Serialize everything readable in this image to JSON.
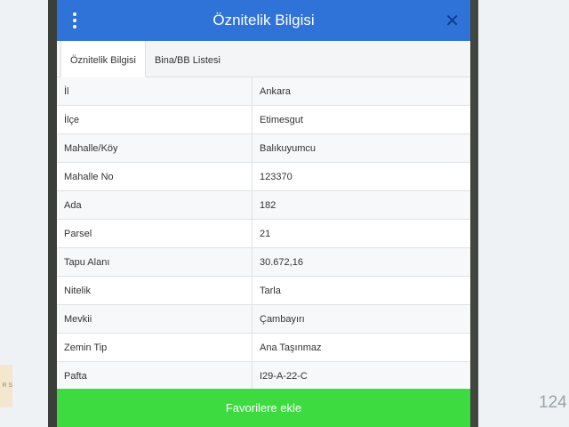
{
  "dialog": {
    "title": "Öznitelik Bilgisi",
    "close_symbol": "✕",
    "tabs": [
      {
        "label": "Öznitelik Bilgisi",
        "active": true
      },
      {
        "label": "Bina/BB Listesi",
        "active": false
      }
    ],
    "rows": [
      {
        "key": "İl",
        "value": "Ankara"
      },
      {
        "key": "İlçe",
        "value": "Etimesgut"
      },
      {
        "key": "Mahalle/Köy",
        "value": "Balıkuyumcu"
      },
      {
        "key": "Mahalle No",
        "value": "123370"
      },
      {
        "key": "Ada",
        "value": "182"
      },
      {
        "key": "Parsel",
        "value": "21"
      },
      {
        "key": "Tapu Alanı",
        "value": "30.672,16"
      },
      {
        "key": "Nitelik",
        "value": "Tarla"
      },
      {
        "key": "Mevkii",
        "value": "Çambayırı"
      },
      {
        "key": "Zemin Tip",
        "value": "Ana Taşınmaz"
      },
      {
        "key": "Pafta",
        "value": "I29-A-22-C"
      }
    ],
    "favorite_button": "Favorilere ekle"
  },
  "background": {
    "logo_text": "R S",
    "corner_number": "124"
  },
  "colors": {
    "header": "#2f72d8",
    "favorite_button": "#3ddb3f",
    "close_icon": "#0e3e8a"
  },
  "icons": {
    "menu": "kebab-menu-icon",
    "close": "close-icon"
  }
}
